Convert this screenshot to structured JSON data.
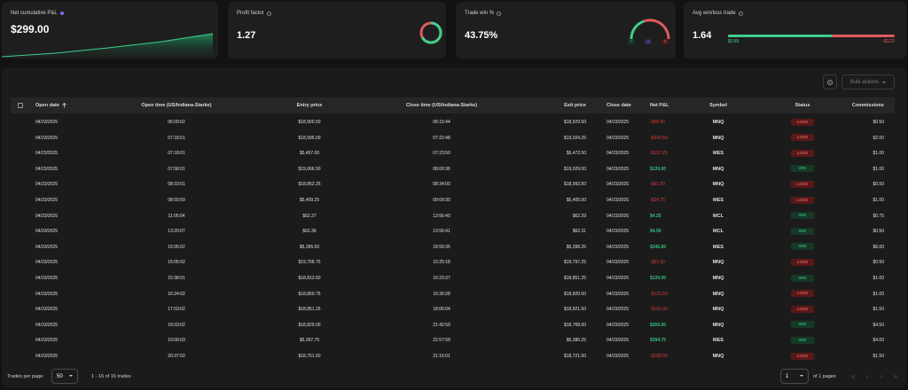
{
  "cards": {
    "net_pnl": {
      "title": "Net cumulative P&L",
      "value": "$299.00"
    },
    "profit_factor": {
      "title": "Profit factor",
      "value": "1.27"
    },
    "trade_win": {
      "title": "Trade win %",
      "value": "43.75%",
      "win_count": "7",
      "neutral_count": "0",
      "loss_count": "9"
    },
    "avg_win_loss": {
      "title": "Avg win/loss trade",
      "value": "1.64",
      "avg_win": "$199",
      "avg_loss": "-$122"
    }
  },
  "toolbar": {
    "settings_icon": "gear-icon",
    "bulk_actions_label": "Bulk actions"
  },
  "table": {
    "headers": {
      "open_date": "Open date",
      "open_time": "Open time (US/Indiana-Starke)",
      "entry_price": "Entry price",
      "close_time": "Close time (US/Indiana-Starke)",
      "exit_price": "Exit price",
      "close_date": "Close date",
      "net_pnl": "Net P&L",
      "symbol": "Symbol",
      "status": "Status",
      "commissions": "Commissions"
    },
    "rows": [
      {
        "open_date": "04/23/2025",
        "open_time": "06:09:02",
        "entry_price": "$18,900.50",
        "close_time": "06:15:44",
        "exit_price": "$18,929.50",
        "close_date": "04/23/2025",
        "net_pnl": "-$58.50",
        "symbol": "MNQ",
        "status": "LOSS",
        "commissions": "$0.50"
      },
      {
        "open_date": "04/23/2025",
        "open_time": "07:18:01",
        "entry_price": "$18,995.00",
        "close_time": "07:22:48",
        "exit_price": "$19,024.25",
        "close_date": "04/23/2025",
        "net_pnl": "-$240.50",
        "symbol": "MNQ",
        "status": "LOSS",
        "commissions": "$2.00"
      },
      {
        "open_date": "04/23/2025",
        "open_time": "07:18:01",
        "entry_price": "$5,457.00",
        "close_time": "07:23:50",
        "exit_price": "$5,472.50",
        "close_date": "04/23/2025",
        "net_pnl": "-$157.25",
        "symbol": "MES",
        "status": "LOSS",
        "commissions": "$1.00"
      },
      {
        "open_date": "04/23/2025",
        "open_time": "07:58:01",
        "entry_price": "$19,066.50",
        "close_time": "08:00:36",
        "exit_price": "$19,029.00",
        "close_date": "04/23/2025",
        "net_pnl": "$139.00",
        "symbol": "MNQ",
        "status": "WIN",
        "commissions": "$1.00"
      },
      {
        "open_date": "04/23/2025",
        "open_time": "08:33:01",
        "entry_price": "$18,862.25",
        "close_time": "08:34:00",
        "exit_price": "$18,993.50",
        "close_date": "04/23/2025",
        "net_pnl": "-$61.00",
        "symbol": "MNQ",
        "status": "LOSS",
        "commissions": "$0.50"
      },
      {
        "open_date": "04/23/2025",
        "open_time": "08:50:59",
        "entry_price": "$5,409.25",
        "close_time": "09:09:30",
        "exit_price": "$5,405.00",
        "close_date": "04/23/2025",
        "net_pnl": "-$24.75",
        "symbol": "MES",
        "status": "LOSS",
        "commissions": "$1.00"
      },
      {
        "open_date": "04/23/2025",
        "open_time": "11:05:04",
        "entry_price": "$62.27",
        "close_time": "13:56:40",
        "exit_price": "$62.29",
        "close_date": "04/23/2025",
        "net_pnl": "$4.25",
        "symbol": "MCL",
        "status": "WIN",
        "commissions": "$0.75"
      },
      {
        "open_date": "04/23/2025",
        "open_time": "13:20:07",
        "entry_price": "$62.36",
        "close_time": "13:56:41",
        "exit_price": "$62.31",
        "close_date": "04/23/2025",
        "net_pnl": "$4.50",
        "symbol": "MCL",
        "status": "WIN",
        "commissions": "$0.50"
      },
      {
        "open_date": "04/23/2025",
        "open_time": "15:05:02",
        "entry_price": "$5,395.50",
        "close_time": "18:59:35",
        "exit_price": "$5,398.25",
        "close_date": "04/23/2025",
        "net_pnl": "$346.50",
        "symbol": "MES",
        "status": "WIN",
        "commissions": "$6.00"
      },
      {
        "open_date": "04/23/2025",
        "open_time": "15:05:02",
        "entry_price": "$19,766.75",
        "close_time": "15:25:18",
        "exit_price": "$19,797.25",
        "close_date": "04/23/2025",
        "net_pnl": "-$61.50",
        "symbol": "MNQ",
        "status": "LOSS",
        "commissions": "$0.50"
      },
      {
        "open_date": "04/23/2025",
        "open_time": "15:38:01",
        "entry_price": "$18,813.50",
        "close_time": "16:23:37",
        "exit_price": "$18,851.25",
        "close_date": "04/23/2025",
        "net_pnl": "$139.00",
        "symbol": "MNQ",
        "status": "WIN",
        "commissions": "$1.00"
      },
      {
        "open_date": "04/23/2025",
        "open_time": "16:24:02",
        "entry_price": "$18,850.75",
        "close_time": "16:30:28",
        "exit_price": "$18,820.50",
        "close_date": "04/23/2025",
        "net_pnl": "-$121.50",
        "symbol": "MNQ",
        "status": "LOSS",
        "commissions": "$1.00"
      },
      {
        "open_date": "04/23/2025",
        "open_time": "17:03:02",
        "entry_price": "$18,851.25",
        "close_time": "18:06:04",
        "exit_price": "$18,821.50",
        "close_date": "04/23/2025",
        "net_pnl": "-$181.00",
        "symbol": "MNQ",
        "status": "LOSS",
        "commissions": "$1.50"
      },
      {
        "open_date": "04/23/2025",
        "open_time": "18:03:02",
        "entry_price": "$18,829.00",
        "close_time": "21:42:59",
        "exit_price": "$18,768.00",
        "close_date": "04/23/2025",
        "net_pnl": "$365.00",
        "symbol": "MNQ",
        "status": "WIN",
        "commissions": "$4.50"
      },
      {
        "open_date": "04/23/2025",
        "open_time": "19:00:03",
        "entry_price": "$5,397.75",
        "close_time": "22:57:59",
        "exit_price": "$5,380.25",
        "close_date": "04/23/2025",
        "net_pnl": "$394.75",
        "symbol": "MES",
        "status": "WIN",
        "commissions": "$4.00"
      },
      {
        "open_date": "04/23/2025",
        "open_time": "20:37:02",
        "entry_price": "$18,751.50",
        "close_time": "21:16:01",
        "exit_price": "$18,721.50",
        "close_date": "04/23/2025",
        "net_pnl": "-$188.00",
        "symbol": "MNQ",
        "status": "LOSS",
        "commissions": "$1.50"
      }
    ]
  },
  "footer": {
    "per_page_label": "Trades per page:",
    "per_page_value": "50",
    "range_text": "1 - 16 of 16 trades",
    "page_value": "1",
    "pages_text": "of 1 pages"
  },
  "colors": {
    "win": "#35c07d",
    "loss": "#d83a3a",
    "card_bg": "#1e1e1e",
    "page_bg": "#121212"
  }
}
